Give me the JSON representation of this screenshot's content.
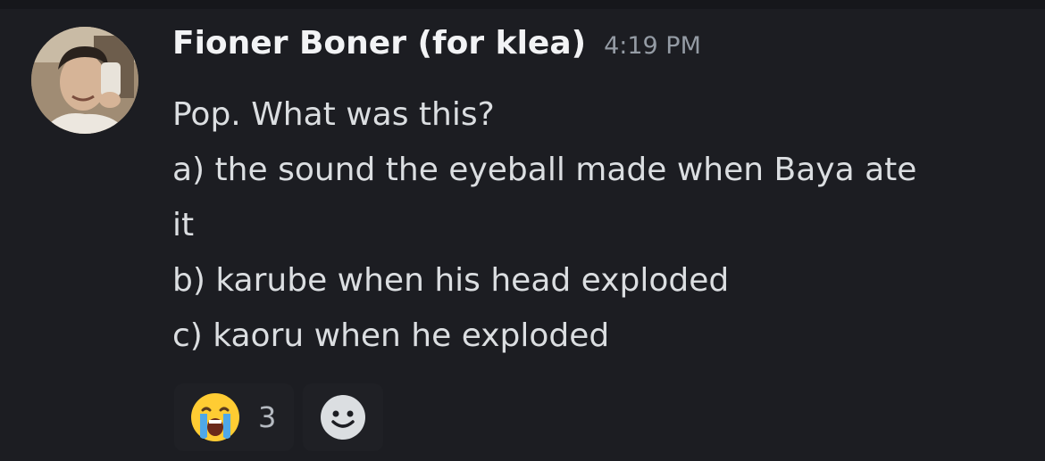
{
  "message": {
    "author": "Fioner Boner (for klea)",
    "timestamp": "4:19 PM",
    "lines": [
      "Pop. What was this?",
      "a) the sound the eyeball made when Baya ate",
      "it",
      "b) karube when his head exploded",
      "c) kaoru when he exploded"
    ]
  },
  "reactions": [
    {
      "emoji": "loudly-crying-face-icon",
      "count": "3"
    }
  ],
  "add_reaction_icon": "add-reaction-smiley-icon",
  "colors": {
    "background": "#1c1d22",
    "username": "#f2f3f5",
    "text": "#dbdee1",
    "timestamp": "#949ba4"
  }
}
